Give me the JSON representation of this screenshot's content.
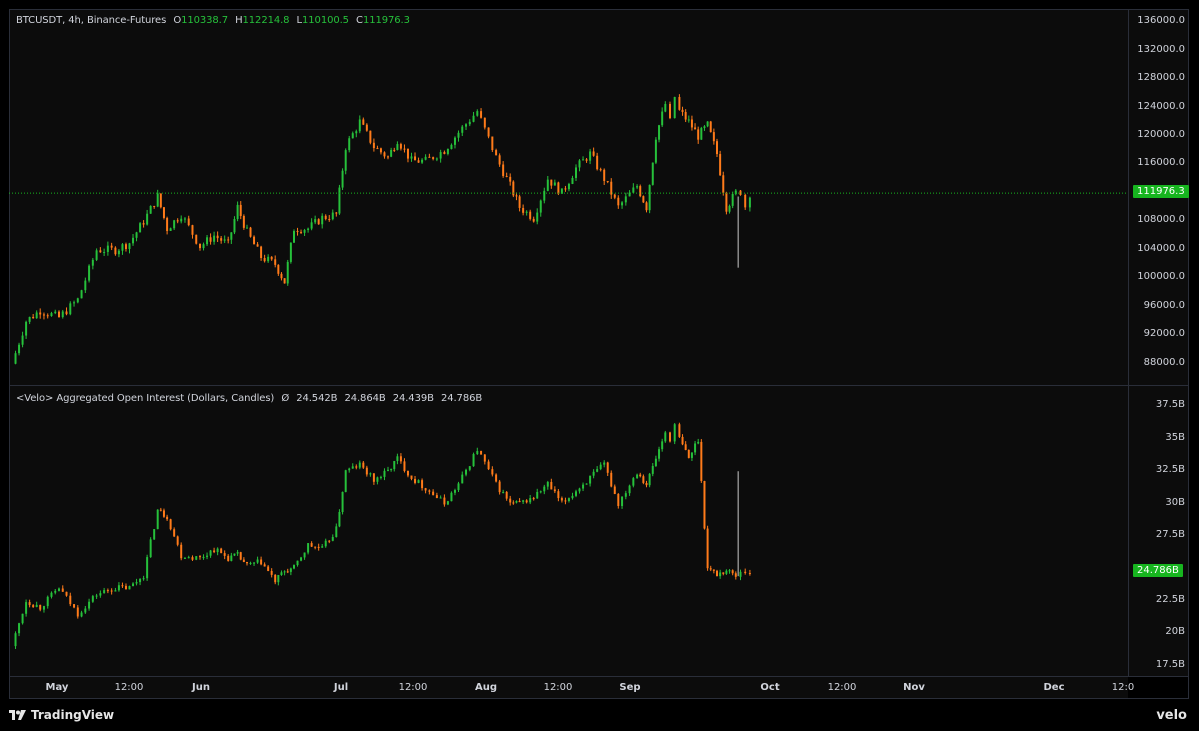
{
  "app": {
    "brand": "TradingView",
    "watermark": "velo"
  },
  "colors": {
    "up": "#26c13b",
    "down": "#ff7b1a",
    "background": "#0c0c0c",
    "price_line": "#17b51f",
    "grid_border": "#2a2e39",
    "wick_down": "#c8c8c8"
  },
  "top_pane": {
    "symbol": "BTCUSDT, 4h, Binance-Futures",
    "ohlc": {
      "o_label": "O",
      "o": "110338.7",
      "h_label": "H",
      "h": "112214.8",
      "l_label": "L",
      "l": "110100.5",
      "c_label": "C",
      "c": "111976.3"
    },
    "last_price": "111976.3",
    "y_ticks": [
      "136000.0",
      "132000.0",
      "128000.0",
      "124000.0",
      "120000.0",
      "116000.0",
      "108000.0",
      "104000.0",
      "100000.0",
      "96000.0",
      "92000.0",
      "88000.0"
    ]
  },
  "bottom_pane": {
    "title": "<Velo> Aggregated Open Interest (Dollars, Candles)",
    "symbol_mark": "Ø",
    "values": [
      "24.542B",
      "24.864B",
      "24.439B",
      "24.786B"
    ],
    "last_value": "24.786B",
    "y_ticks": [
      "37.5B",
      "35B",
      "32.5B",
      "30B",
      "27.5B",
      "22.5B",
      "20B",
      "17.5B"
    ]
  },
  "x_ticks": [
    {
      "label": "May",
      "bold": true
    },
    {
      "label": "12:00",
      "bold": false
    },
    {
      "label": "Jun",
      "bold": true
    },
    {
      "label": "Jul",
      "bold": true
    },
    {
      "label": "12:00",
      "bold": false
    },
    {
      "label": "Aug",
      "bold": true
    },
    {
      "label": "12:00",
      "bold": false
    },
    {
      "label": "Sep",
      "bold": true
    },
    {
      "label": "Oct",
      "bold": true
    },
    {
      "label": "12:00",
      "bold": false
    },
    {
      "label": "Nov",
      "bold": true
    },
    {
      "label": "Dec",
      "bold": true
    },
    {
      "label": "12:0",
      "bold": false
    }
  ],
  "chart_data": [
    {
      "type": "line",
      "title": "BTCUSDT, 4h, Binance-Futures",
      "ylim": [
        86000,
        137000
      ],
      "series": [
        {
          "name": "BTCUSDT",
          "x_days": [
            0,
            3,
            6,
            10,
            14,
            18,
            22,
            25,
            28,
            31,
            33,
            36,
            40,
            43,
            46,
            48,
            50,
            53,
            56,
            58,
            60,
            63,
            66,
            69,
            71,
            74,
            77,
            80,
            82,
            85,
            88,
            92,
            95,
            99,
            103,
            106,
            108,
            111,
            114,
            117,
            120,
            123,
            126,
            129,
            133,
            135,
            137,
            139,
            140,
            141,
            142,
            144,
            146,
            148,
            150,
            152,
            154,
            155,
            156,
            157
          ],
          "values": [
            88000,
            94000,
            95500,
            94500,
            97000,
            104000,
            104000,
            105000,
            108000,
            111500,
            107000,
            109000,
            104500,
            106000,
            104800,
            110000,
            106500,
            103000,
            102000,
            99500,
            107000,
            107000,
            108500,
            109000,
            118500,
            122000,
            118500,
            117000,
            119500,
            116500,
            116500,
            118000,
            120500,
            123500,
            117000,
            113000,
            110000,
            108500,
            114000,
            112000,
            115500,
            117500,
            114000,
            110000,
            113000,
            110000,
            120000,
            124500,
            122000,
            125500,
            123500,
            122000,
            120000,
            121500,
            117500,
            110000,
            112000,
            112200,
            110100,
            111976
          ]
        }
      ]
    },
    {
      "type": "line",
      "title": "<Velo> Aggregated Open Interest (Dollars, Candles)",
      "ylim": [
        17000,
        38000
      ],
      "series": [
        {
          "name": "Aggregated Open Interest",
          "x_days": [
            0,
            3,
            6,
            10,
            14,
            18,
            22,
            25,
            28,
            31,
            33,
            36,
            40,
            43,
            46,
            48,
            50,
            53,
            56,
            58,
            60,
            63,
            66,
            69,
            71,
            74,
            77,
            80,
            82,
            85,
            88,
            92,
            95,
            99,
            103,
            106,
            108,
            111,
            114,
            117,
            120,
            123,
            126,
            129,
            133,
            135,
            137,
            139,
            140,
            141,
            142,
            144,
            146,
            148,
            150,
            152,
            154,
            155,
            156,
            157
          ],
          "values": [
            19000,
            22500,
            22000,
            23500,
            21500,
            23000,
            23500,
            23500,
            24500,
            29500,
            29000,
            26000,
            25800,
            26500,
            25800,
            26000,
            25200,
            25500,
            24000,
            24800,
            25000,
            26800,
            26500,
            28000,
            32500,
            33000,
            31800,
            32500,
            33500,
            32000,
            31200,
            30000,
            31500,
            34200,
            31500,
            30000,
            30000,
            30500,
            31500,
            30000,
            31000,
            32000,
            33000,
            30000,
            32500,
            31500,
            33500,
            35500,
            35000,
            36000,
            35000,
            33500,
            35000,
            25000,
            24542,
            24864,
            24439,
            24786,
            24786,
            24786
          ]
        }
      ]
    }
  ]
}
